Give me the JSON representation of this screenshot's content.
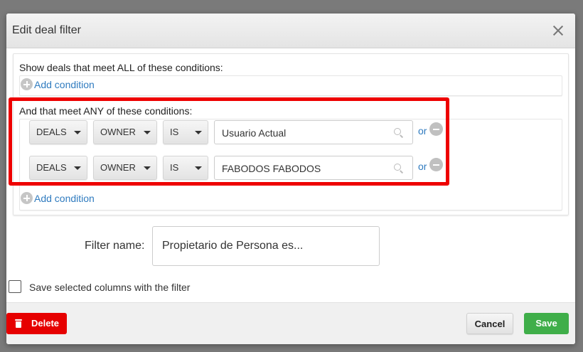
{
  "dialog": {
    "title": "Edit deal filter",
    "close_icon": "close-icon"
  },
  "all_section": {
    "label": "Show deals that meet ALL of these conditions:",
    "add_label": "Add condition"
  },
  "any_section": {
    "label": "And that meet ANY of these conditions:",
    "add_label": "Add condition",
    "rows": [
      {
        "object": "DEALS",
        "field": "OWNER",
        "operator": "IS",
        "value": "Usuario Actual",
        "or_label": "or"
      },
      {
        "object": "DEALS",
        "field": "OWNER",
        "operator": "IS",
        "value": "FABODOS FABODOS",
        "or_label": "or"
      }
    ]
  },
  "filter_name": {
    "label": "Filter name:",
    "value": "Propietario de Persona es..."
  },
  "save_columns": {
    "label": "Save selected columns with the filter",
    "checked": false
  },
  "footer": {
    "delete_label": "Delete",
    "cancel_label": "Cancel",
    "save_label": "Save"
  },
  "colors": {
    "highlight": "#ee0000",
    "link": "#2f7bbf",
    "delete": "#e60000",
    "save": "#3fae49"
  }
}
